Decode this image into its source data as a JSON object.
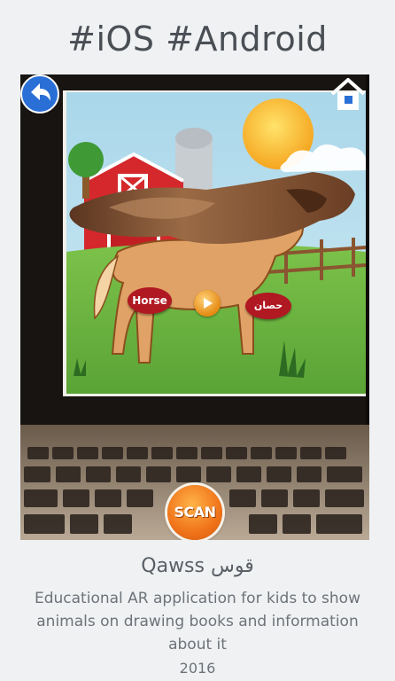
{
  "page": {
    "heading": "#iOS #Android"
  },
  "screenshot": {
    "label_en": "Horse",
    "label_ar": "حصان",
    "scan_label": "SCAN",
    "icons": {
      "back": "back-arrow-icon",
      "home": "home-icon",
      "play": "play-icon"
    },
    "colors": {
      "label": "#b01822",
      "scan": "#f0731a",
      "back": "#2a6fd6"
    }
  },
  "project": {
    "title": "Qawss قوس",
    "description": "Educational AR application for kids to show animals on drawing books and information about it",
    "year": "2016"
  }
}
